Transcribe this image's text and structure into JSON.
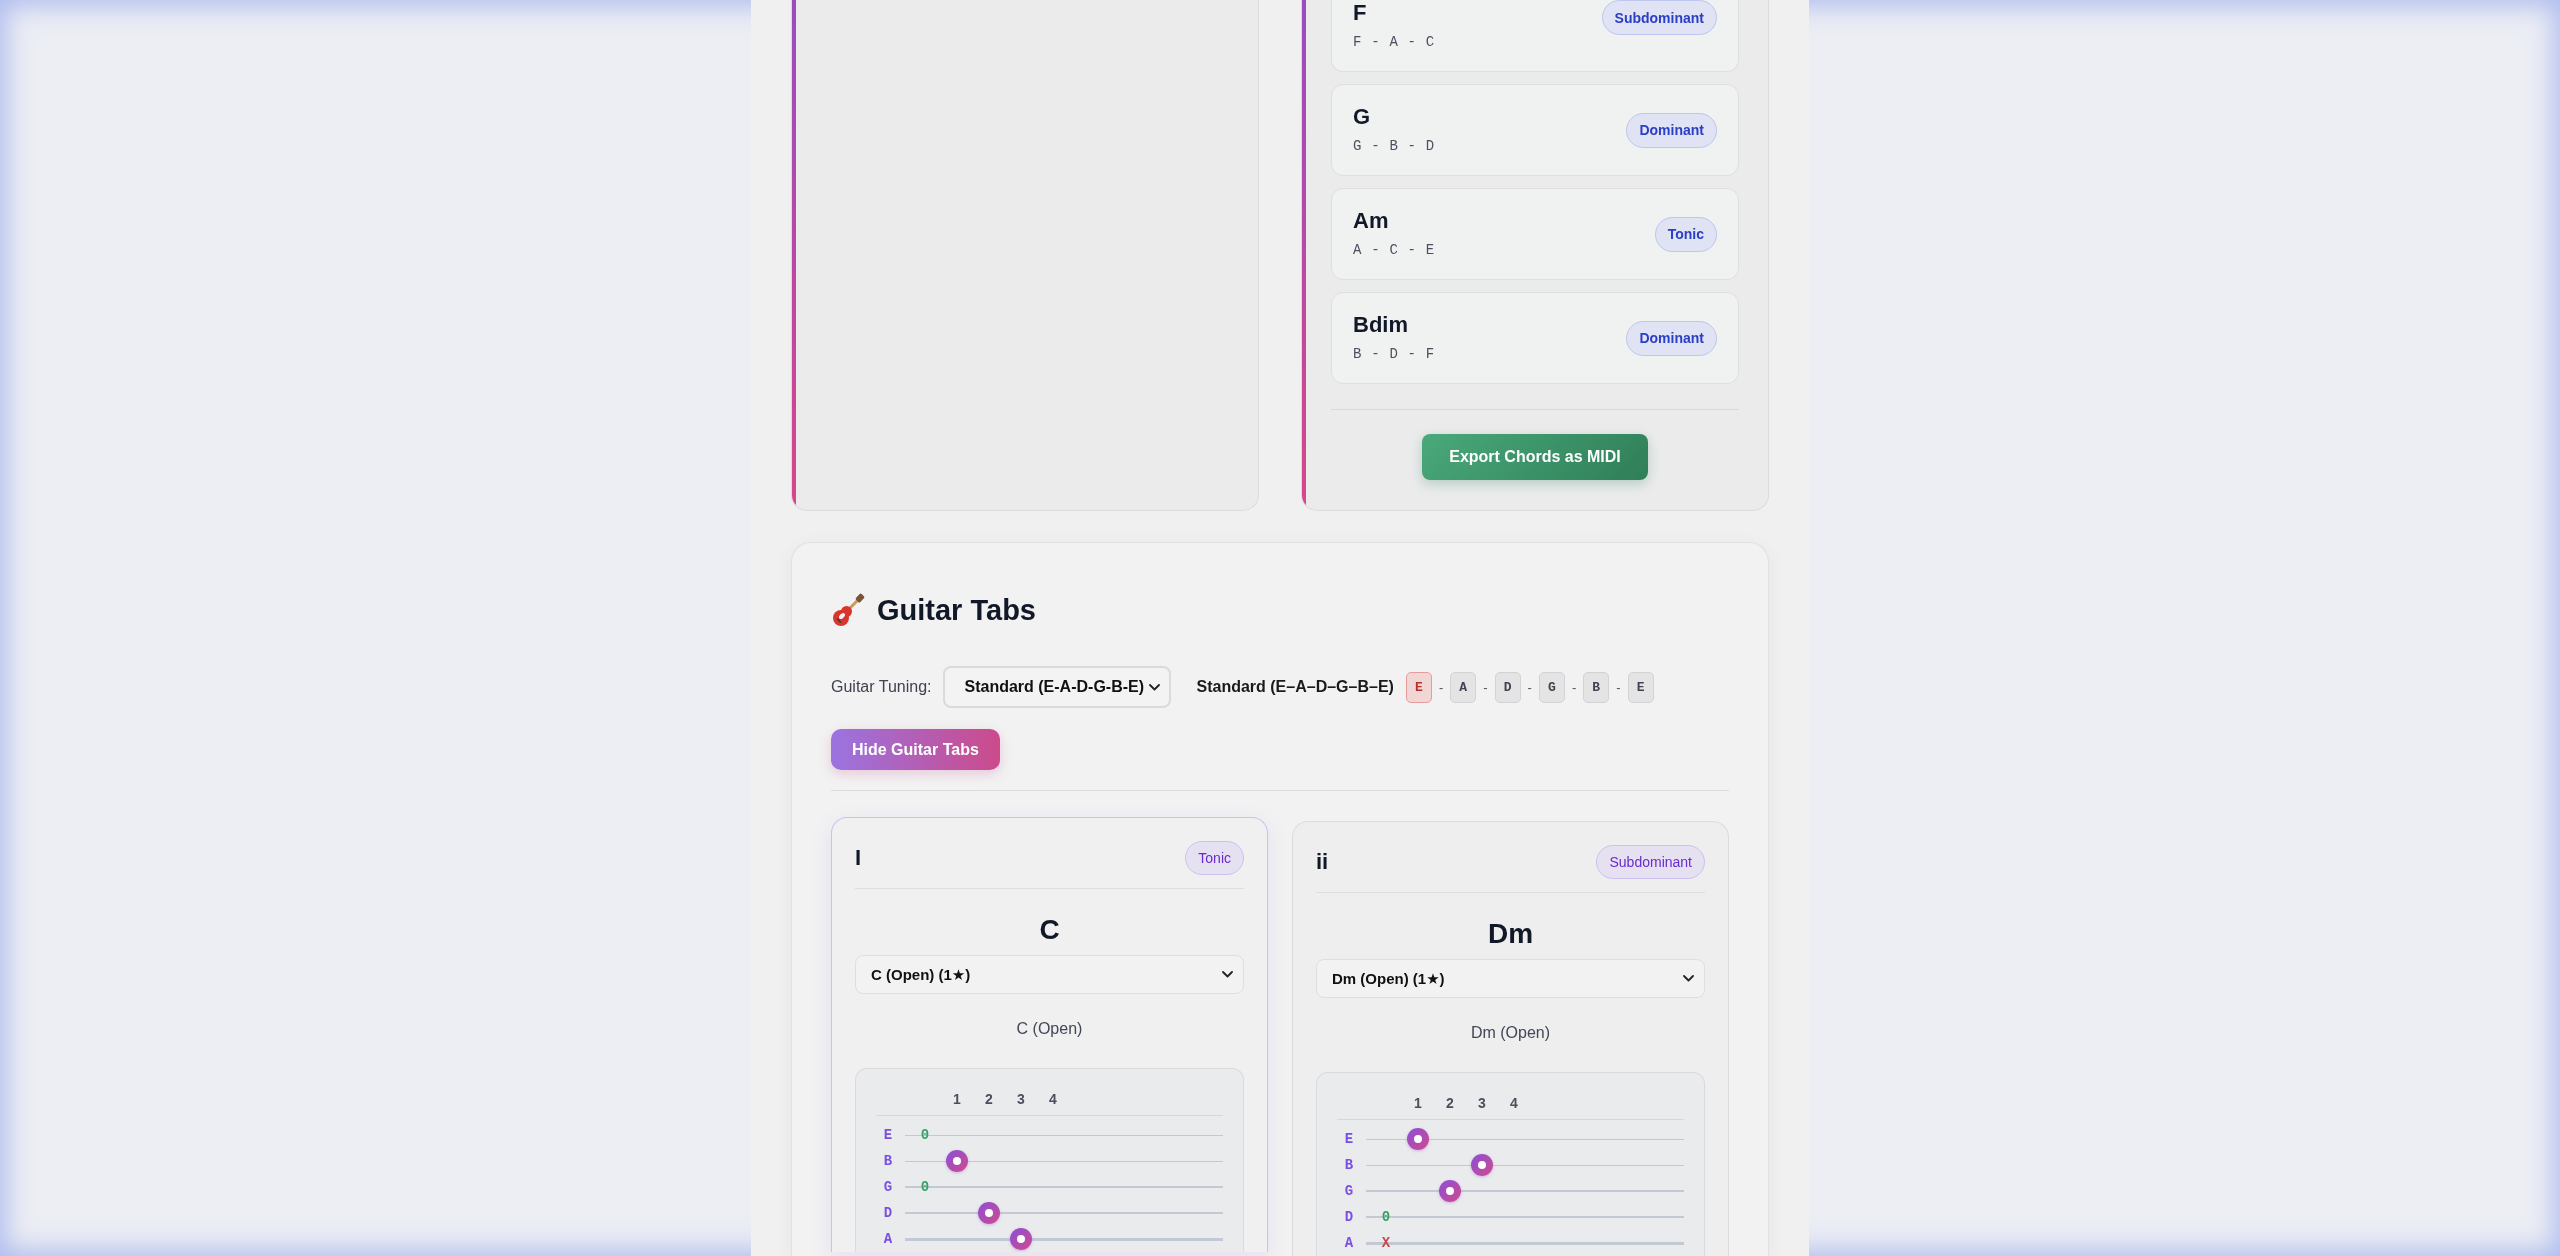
{
  "chord_list": {
    "chords": [
      {
        "name": "F",
        "notes": "F - A - C",
        "function": "Subdominant"
      },
      {
        "name": "G",
        "notes": "G - B - D",
        "function": "Dominant"
      },
      {
        "name": "Am",
        "notes": "A - C - E",
        "function": "Tonic"
      },
      {
        "name": "Bdim",
        "notes": "B - D - F",
        "function": "Dominant"
      }
    ],
    "export_button": "Export Chords as MIDI"
  },
  "guitar_tabs": {
    "title": "Guitar Tabs",
    "tuning_label": "Guitar Tuning:",
    "tuning_select": "Standard (E-A-D-G-B-E)",
    "tuning_name": "Standard (E–A–D–G–B–E)",
    "tuning_notes": [
      {
        "label": "E",
        "highlighted": true
      },
      {
        "label": "A",
        "highlighted": false
      },
      {
        "label": "D",
        "highlighted": false
      },
      {
        "label": "G",
        "highlighted": false
      },
      {
        "label": "B",
        "highlighted": false
      },
      {
        "label": "E",
        "highlighted": false
      }
    ],
    "tuning_separators": [
      "-",
      "-",
      "-",
      "-",
      "-"
    ],
    "toggle_button": "Hide Guitar Tabs",
    "cards": [
      {
        "numeral": "I",
        "function": "Tonic",
        "active": true,
        "chord": "C",
        "voicing_select": "C (Open) (1★)",
        "voicing_name": "C (Open)",
        "fret_numbers": [
          "1",
          "2",
          "3",
          "4"
        ],
        "strings": [
          {
            "name": "E",
            "kind": "open",
            "symbol": "0",
            "frets": [
              {
                "pressed": false
              },
              {
                "pressed": false
              },
              {
                "pressed": false
              },
              {
                "pressed": false
              }
            ]
          },
          {
            "name": "B",
            "kind": "fretted",
            "frets": [
              {
                "pressed": true
              },
              {
                "pressed": false
              },
              {
                "pressed": false
              },
              {
                "pressed": false
              }
            ]
          },
          {
            "name": "G",
            "kind": "open",
            "symbol": "0",
            "frets": [
              {
                "pressed": false
              },
              {
                "pressed": false
              },
              {
                "pressed": false
              },
              {
                "pressed": false
              }
            ]
          },
          {
            "name": "D",
            "kind": "fretted",
            "frets": [
              {
                "pressed": false
              },
              {
                "pressed": true
              },
              {
                "pressed": false
              },
              {
                "pressed": false
              }
            ]
          },
          {
            "name": "A",
            "kind": "fretted",
            "frets": [
              {
                "pressed": false
              },
              {
                "pressed": false
              },
              {
                "pressed": true
              },
              {
                "pressed": false
              }
            ]
          }
        ]
      },
      {
        "numeral": "ii",
        "function": "Subdominant",
        "active": false,
        "chord": "Dm",
        "voicing_select": "Dm (Open) (1★)",
        "voicing_name": "Dm (Open)",
        "fret_numbers": [
          "1",
          "2",
          "3",
          "4"
        ],
        "strings": [
          {
            "name": "E",
            "kind": "fretted",
            "frets": [
              {
                "pressed": true
              },
              {
                "pressed": false
              },
              {
                "pressed": false
              },
              {
                "pressed": false
              }
            ]
          },
          {
            "name": "B",
            "kind": "fretted",
            "frets": [
              {
                "pressed": false
              },
              {
                "pressed": false
              },
              {
                "pressed": true
              },
              {
                "pressed": false
              }
            ]
          },
          {
            "name": "G",
            "kind": "fretted",
            "frets": [
              {
                "pressed": false
              },
              {
                "pressed": true
              },
              {
                "pressed": false
              },
              {
                "pressed": false
              }
            ]
          },
          {
            "name": "D",
            "kind": "open",
            "symbol": "0",
            "frets": [
              {
                "pressed": false
              },
              {
                "pressed": false
              },
              {
                "pressed": false
              },
              {
                "pressed": false
              }
            ]
          },
          {
            "name": "A",
            "kind": "muted",
            "symbol": "X",
            "frets": [
              {
                "pressed": false
              },
              {
                "pressed": false
              },
              {
                "pressed": false
              },
              {
                "pressed": false
              }
            ]
          }
        ]
      }
    ]
  }
}
